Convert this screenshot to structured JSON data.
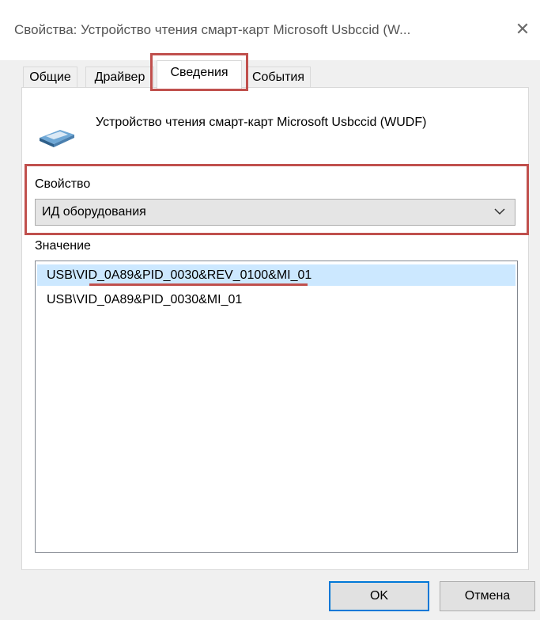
{
  "window": {
    "title": "Свойства: Устройство чтения смарт-карт Microsoft Usbccid (W...",
    "close_glyph": "✕"
  },
  "tabs": [
    {
      "label": "Общие",
      "active": false
    },
    {
      "label": "Драйвер",
      "active": false
    },
    {
      "label": "Сведения",
      "active": true
    },
    {
      "label": "События",
      "active": false
    }
  ],
  "device": {
    "name": "Устройство чтения смарт-карт Microsoft Usbccid (WUDF)",
    "icon": "smart-card-reader-icon"
  },
  "property": {
    "label": "Свойство",
    "selected": "ИД оборудования"
  },
  "value": {
    "label": "Значение",
    "items": [
      "USB\\VID_0A89&PID_0030&REV_0100&MI_01",
      "USB\\VID_0A89&PID_0030&MI_01"
    ],
    "selected_index": 0
  },
  "buttons": {
    "ok": "OK",
    "cancel": "Отмена"
  },
  "colors": {
    "highlight": "#c0504d",
    "selection": "#cce8ff",
    "focus": "#0078d7"
  }
}
